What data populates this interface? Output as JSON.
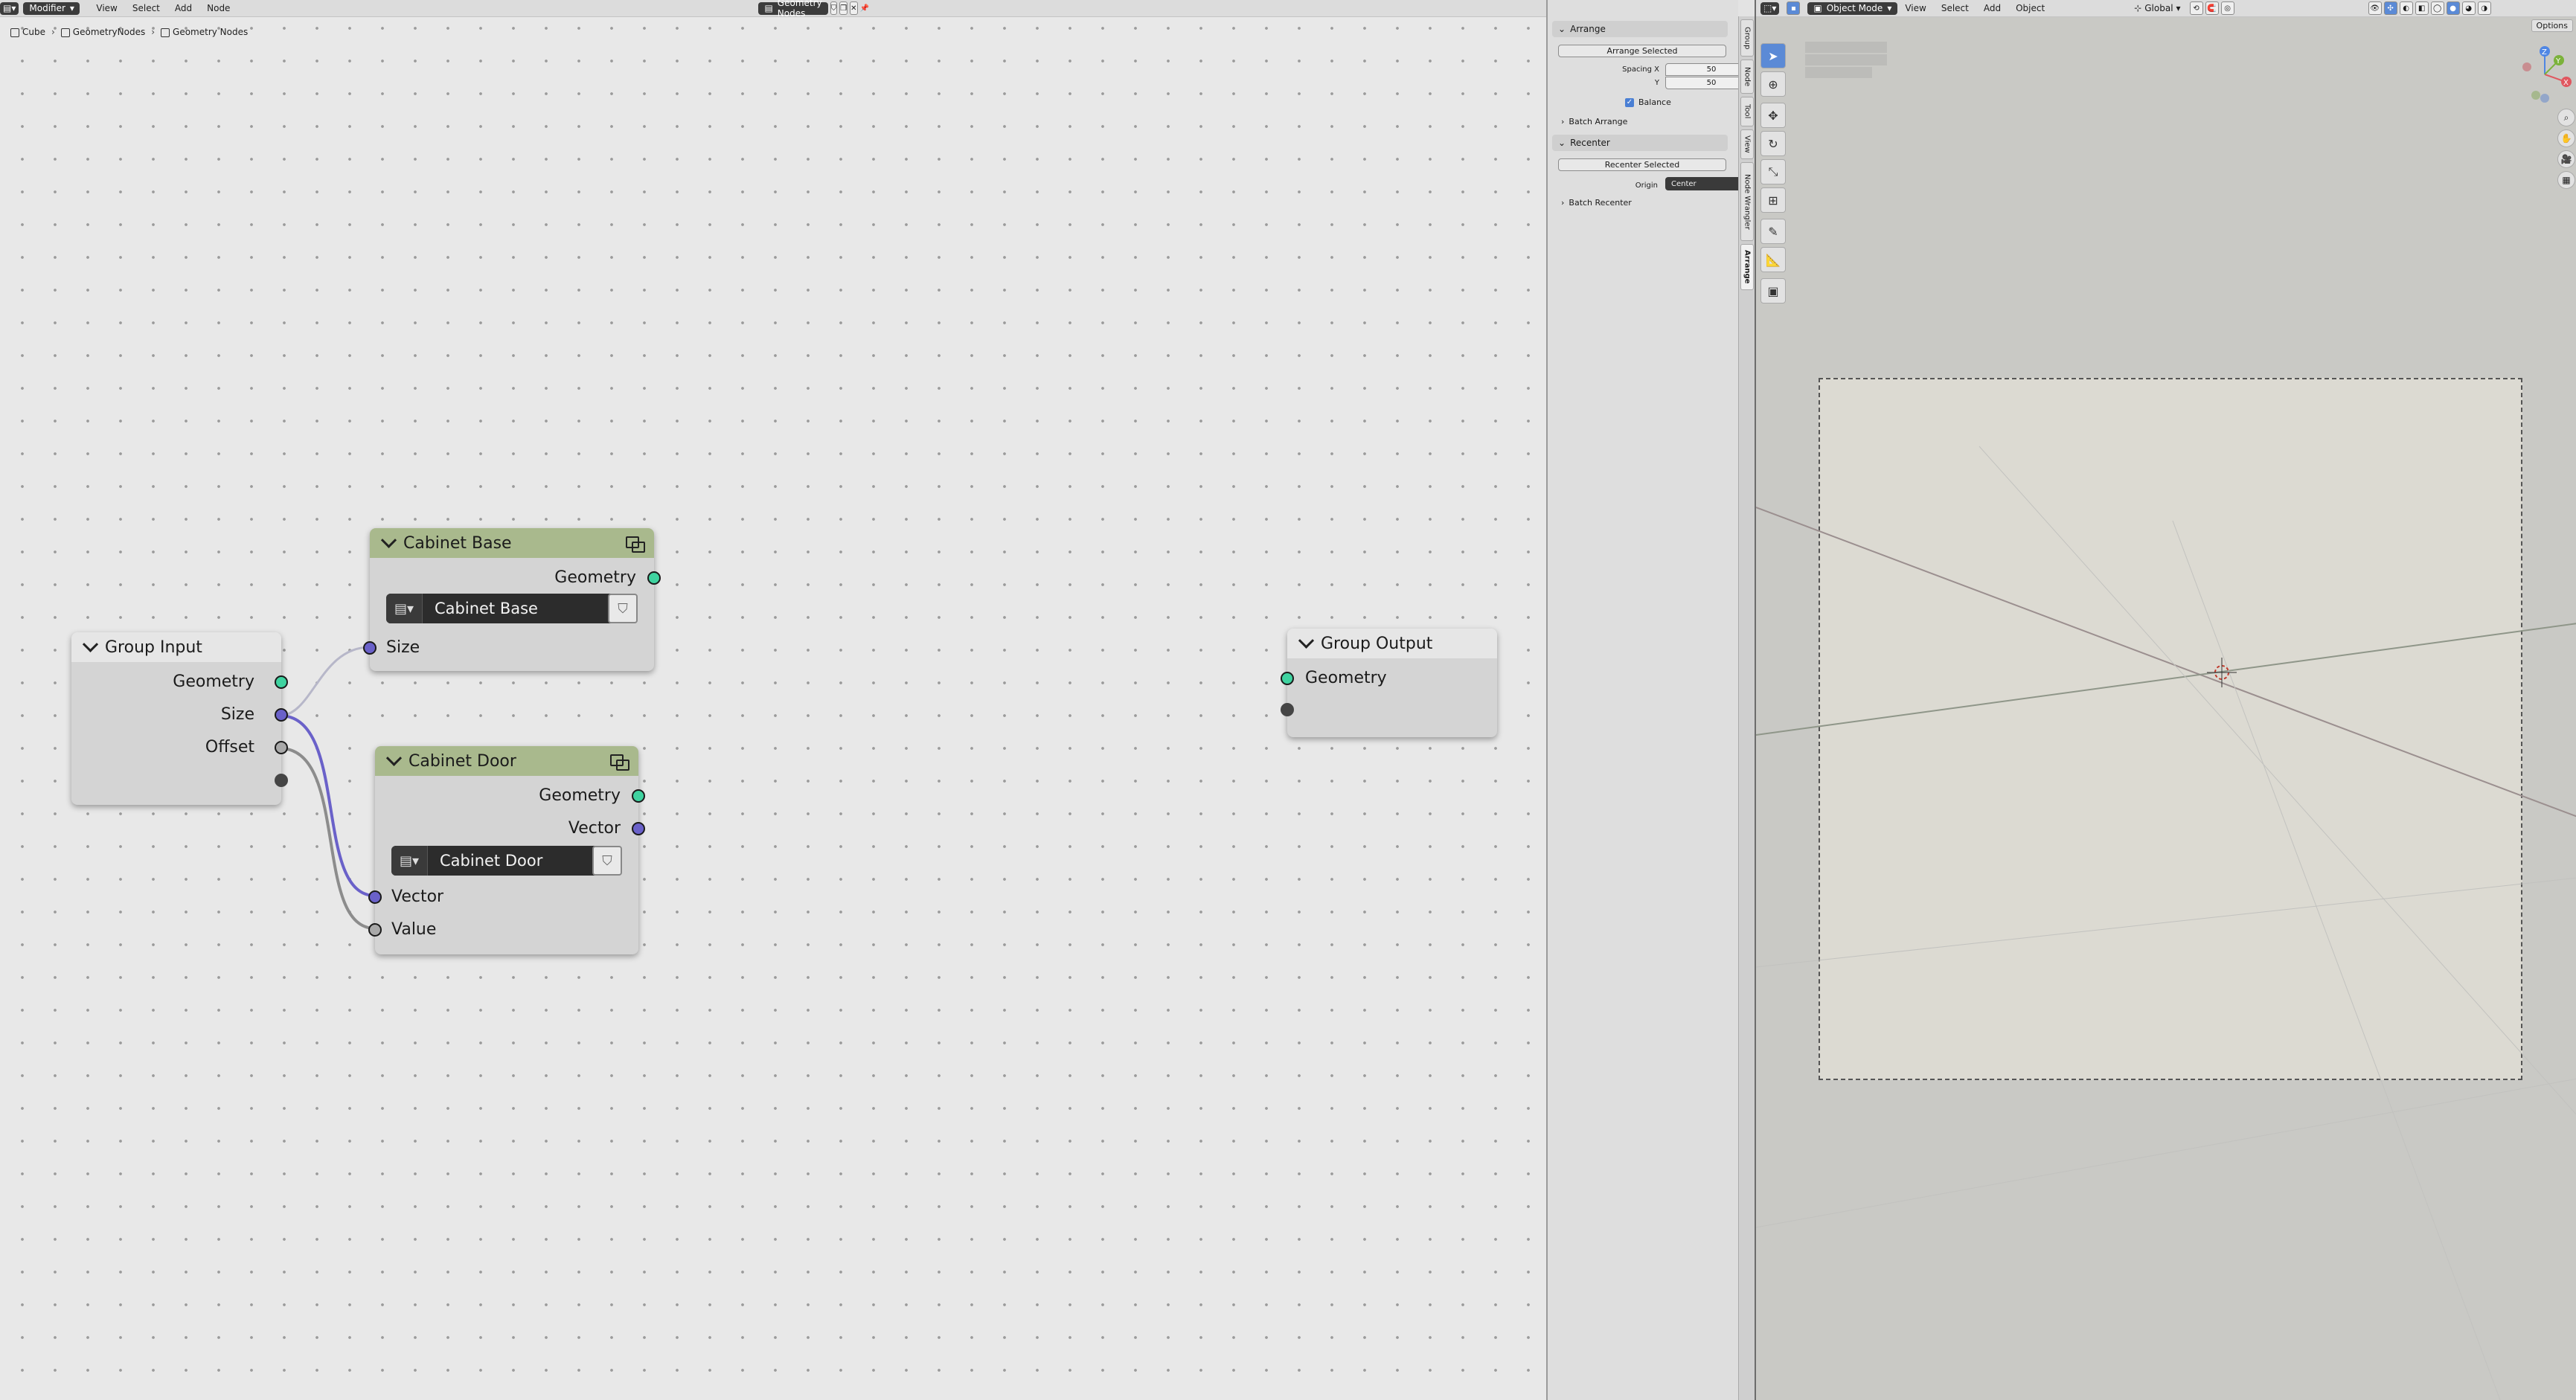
{
  "node_editor": {
    "header": {
      "editor_menu": "Modifier",
      "menus": [
        "View",
        "Select",
        "Add",
        "Node"
      ],
      "node_group_name": "Geometry Nodes"
    },
    "breadcrumb": [
      "Cube",
      "GeometryNodes",
      "Geometry Nodes"
    ],
    "nodes": {
      "group_input": {
        "title": "Group Input",
        "outputs": [
          "Geometry",
          "Size",
          "Offset"
        ]
      },
      "cabinet_base": {
        "title": "Cabinet Base",
        "outputs": [
          "Geometry"
        ],
        "group_name": "Cabinet Base",
        "inputs": [
          "Size"
        ]
      },
      "cabinet_door": {
        "title": "Cabinet Door",
        "outputs": [
          "Geometry",
          "Vector"
        ],
        "group_name": "Cabinet Door",
        "inputs": [
          "Vector",
          "Value"
        ]
      },
      "group_output": {
        "title": "Group Output",
        "inputs": [
          "Geometry"
        ]
      }
    }
  },
  "sidebar": {
    "arrange": {
      "title": "Arrange",
      "button": "Arrange Selected",
      "spacing_label": "Spacing X",
      "y_label": "Y",
      "spacing_x": "50",
      "spacing_y": "50",
      "balance_label": "Balance",
      "balance_checked": true,
      "batch": "Batch Arrange"
    },
    "recenter": {
      "title": "Recenter",
      "button": "Recenter Selected",
      "origin_label": "Origin",
      "origin_value": "Center",
      "batch": "Batch Recenter"
    },
    "tabs": [
      "Group",
      "Node",
      "Tool",
      "View",
      "Node Wrangler",
      "Arrange"
    ]
  },
  "viewport": {
    "header": {
      "mode": "Object Mode",
      "menus": [
        "View",
        "Select",
        "Add",
        "Object"
      ],
      "orientation": "Global",
      "options": "Options"
    },
    "gizmo_axes": [
      "X",
      "Y",
      "Z"
    ]
  },
  "colors": {
    "geometry_socket": "#3fd3a0",
    "vector_socket": "#6a61c9",
    "value_socket": "#a9a9a9",
    "group_node_header": "#a9b98d",
    "selection_blue": "#5b8ad6"
  }
}
